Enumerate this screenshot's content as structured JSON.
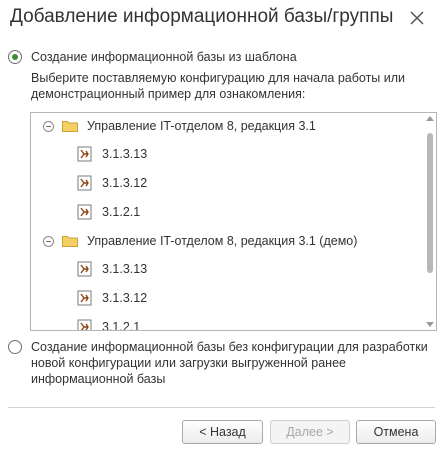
{
  "dialog": {
    "title": "Добавление информационной базы/группы"
  },
  "options": {
    "from_template": {
      "label": "Создание информационной базы из шаблона",
      "selected": true,
      "hint": "Выберите поставляемую конфигурацию для начала работы или демонстрационный пример для ознакомления:"
    },
    "empty": {
      "label": "Создание информационной базы без конфигурации для разработки новой конфигурации или загрузки выгруженной ранее информационной базы",
      "selected": false
    }
  },
  "tree": {
    "groups": [
      {
        "label": "Управление IT-отделом 8, редакция 3.1",
        "icon": "folder-icon",
        "expanded": true,
        "items": [
          "3.1.3.13",
          "3.1.3.12",
          "3.1.2.1"
        ]
      },
      {
        "label": "Управление IT-отделом 8, редакция 3.1 (демо)",
        "icon": "folder-icon",
        "expanded": true,
        "items": [
          "3.1.3.13",
          "3.1.3.12",
          "3.1.2.1"
        ]
      }
    ]
  },
  "buttons": {
    "back": "< Назад",
    "next": "Далее >",
    "cancel": "Отмена"
  },
  "colors": {
    "radio_selected": "#3a8c3a",
    "folder": "#f0c14b",
    "config_icon": "#8b4513"
  }
}
